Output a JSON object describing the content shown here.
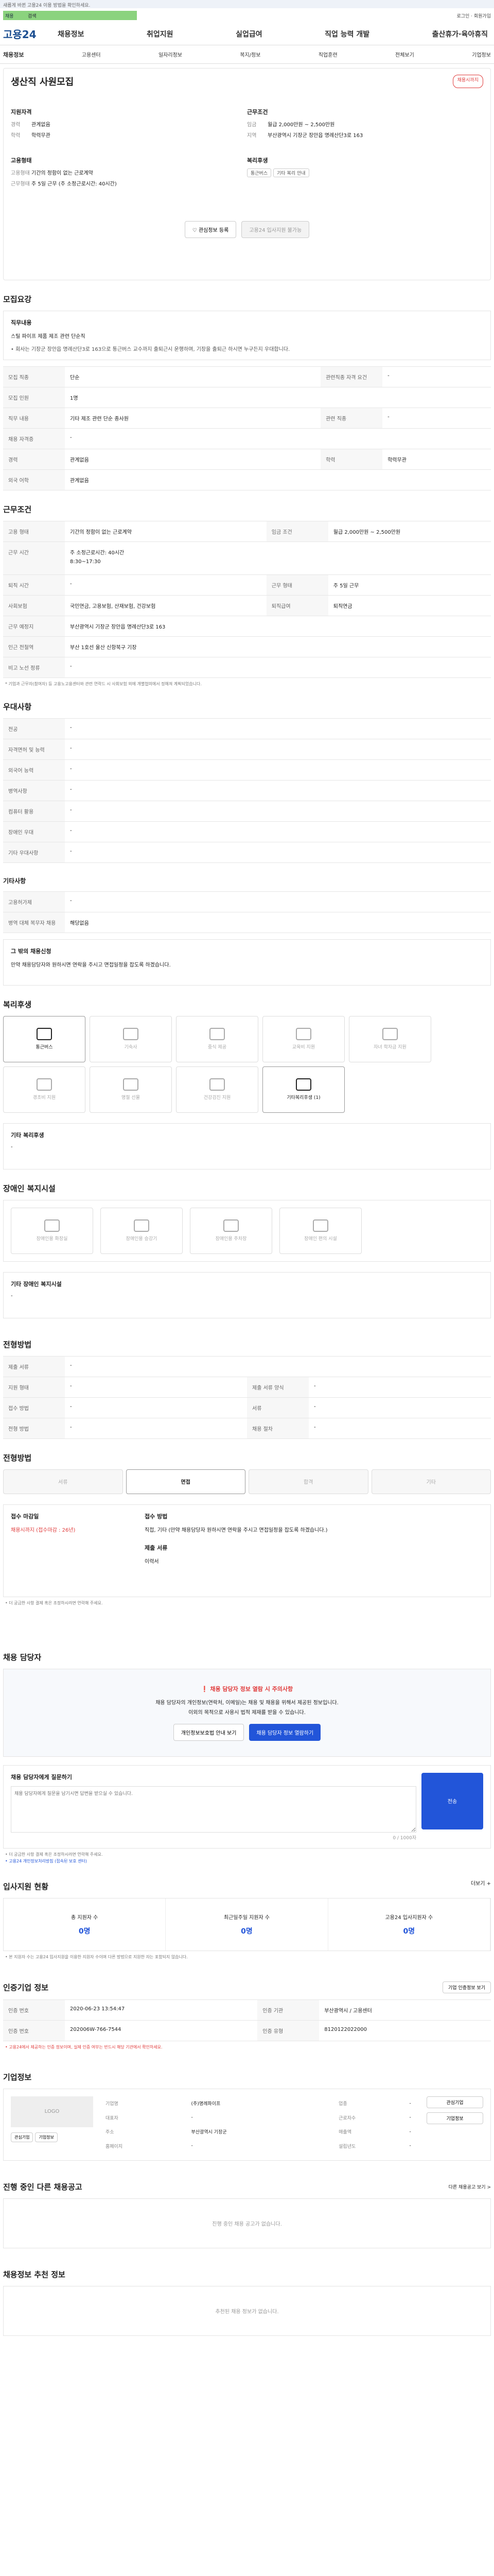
{
  "topbar": {
    "notice": "새롭게 바뀐 고용24 이용 방법을 확인하세요.",
    "search_prefix": "채용",
    "search_value": "검색",
    "right": "로그인 · 회원가입"
  },
  "gnb": {
    "logo": "고용24",
    "menu": [
      "채용정보",
      "취업지원",
      "실업급여",
      "직업 능력 개발",
      "출산휴가·육아휴직"
    ]
  },
  "lnb": [
    "채용정보",
    "고용센터",
    "일자리정보",
    "복지/정보",
    "직업훈련",
    "전체보기",
    "기업정보"
  ],
  "job": {
    "title": "생산직 사원모집",
    "badge": "채용시까지",
    "apply_label": "지원자격",
    "career_label": "경력",
    "career": "관계없음",
    "edu_label": "학력",
    "edu": "학력무관",
    "cond_title": "근무조건",
    "pay_label": "임금",
    "pay": "월급 2,000만원 ~ 2,500만원",
    "loc_label": "지역",
    "loc": "부산광역시 기장군 장안읍 명례산단3로 163",
    "type_title": "고용형태",
    "type_label": "고용형태",
    "type_val": "기간의 정함이 없는 근로계약",
    "hours_label": "근무형태",
    "hours_val": "주 5일 근무 (주 소정근로시간: 40시간)",
    "welfare_title": "복리후생",
    "tags": [
      "통근버스",
      "기타 복리 안내"
    ],
    "btn_save": "관심정보 등록",
    "btn_apply": "고용24 입사지원 불가능"
  },
  "sections": {
    "recruit": "모집요강",
    "cond": "근무조건",
    "pref": "우대사항",
    "welfare": "복리후생",
    "disabled": "장애인 복지시설",
    "selection": "전형방법",
    "contact": "채용 담당자",
    "stats": "입사지원 현황",
    "company": "인증기업 정보",
    "corp": "기업정보",
    "other": "진행 중인 다른 채용공고",
    "ai": "채용정보 추천 정보"
  },
  "recruit": {
    "box_title": "직무내용",
    "box_text": "스틸 파이프 제품 제조 관련 단순직",
    "box_note": "• 회사는 기장군 장안읍 명례산단3로 163으로 통근버스 교수까지 출퇴근시 운행하며, 기장을 출퇴근 하시면 누구든지 우대합니다.",
    "rows": [
      [
        "모집 직종",
        "단순",
        "관련직종 자격 요건",
        "-"
      ],
      [
        "모집 인원",
        "1명",
        "",
        ""
      ],
      [
        "직무 내용",
        "기타 제조 관련 단순 종사원",
        "관련 직종",
        "-"
      ],
      [
        "채용 자격증",
        "-",
        "",
        ""
      ],
      [
        "경력",
        "관계없음",
        "학력",
        "학력무관"
      ],
      [
        "외국 어학",
        "관계없음",
        "",
        ""
      ]
    ]
  },
  "cond": {
    "rows": [
      [
        "고용 형태",
        "기간의 정함이 없는 근로계약",
        "임금 조건",
        "월급 2,000만원 ~ 2,500만원"
      ],
      [
        "근무 시간",
        "주 소정근로시간: 40시간",
        "근무형태",
        "주 5일 근무"
      ],
      [
        "퇴직 시간",
        "-",
        "근무 형태",
        "주 5일 근무"
      ],
      [
        "사회보험",
        "국민연금, 고용보험, 산재보험, 건강보험",
        "퇴직급여",
        "퇴직연금"
      ],
      [
        "근무 예정지",
        "부산광역시 기장군 장안읍 명례산단3로 163",
        "",
        ""
      ],
      [
        "인근 전철역",
        "부산 1호선 울산 신항북구 기장",
        "",
        ""
      ],
      [
        "비고 노선 정류",
        "-",
        "",
        ""
      ]
    ],
    "hours_detail": "8:30~17:30",
    "note": "* 기업과 근무자(참여자) 등 고용노고용센터와 관련 연락드 시 사회보험 외에 개별협의에서 정해져 계획되었습니다."
  },
  "pref": {
    "rows": [
      [
        "전공",
        "-"
      ],
      [
        "자격면허 및 능력",
        "-"
      ],
      [
        "외국어 능력",
        "-"
      ],
      [
        "병역사항",
        "-"
      ],
      [
        "컴퓨터 활용",
        "-"
      ],
      [
        "장애인 우대",
        "-"
      ],
      [
        "기타 우대사항",
        "-"
      ]
    ],
    "sub_title": "기타사항",
    "sub_rows": [
      [
        "고용허가제",
        "-"
      ],
      [
        "병역 대체 복무자 채용",
        "해당없음"
      ]
    ],
    "etc_title": "그 밖의 채용신청",
    "etc_text": "만약 채용담당자와 원하시면 연락을 주시고 면접일정을 잡도록 하겠습니다."
  },
  "welfare": {
    "items": [
      {
        "label": "통근버스",
        "on": true
      },
      {
        "label": "기숙사",
        "on": false
      },
      {
        "label": "중식 제공",
        "on": false
      },
      {
        "label": "교육비 지원",
        "on": false
      },
      {
        "label": "자녀 학자금 지원",
        "on": false
      },
      {
        "label": "경조비 지원",
        "on": false
      },
      {
        "label": "명절 선물",
        "on": false
      },
      {
        "label": "건강검진 지원",
        "on": false
      },
      {
        "label": "기타복리후생 (1)",
        "on": true
      }
    ],
    "etc_label": "기타 복리후생",
    "etc_text": "-"
  },
  "disabled": {
    "items": [
      "장애인용 화장실",
      "장애인용 승강기",
      "장애인용 주차장",
      "장애인 편의 시설"
    ],
    "etc_label": "기타 장애인 복지시설",
    "etc_text": "-"
  },
  "selection": {
    "rows": [
      [
        "제출 서류",
        "-",
        "",
        ""
      ],
      [
        "지원 형태",
        "-",
        "제출 서류 양식",
        "-"
      ],
      [
        "접수 방법",
        "-",
        "서류",
        "-"
      ],
      [
        "전형 방법",
        "-",
        "채용 절차",
        "-"
      ]
    ],
    "steps": [
      "서류",
      "면접",
      "합격",
      "기타"
    ],
    "active": 1,
    "deadline_label": "접수 마감일",
    "deadline": "채용시까지 (접수마감 : 26년)",
    "method_label": "접수 방법",
    "method_text": "직접, 기타 (만약 채용담당자 원하시면 연락을 주시고 면접일정을 잡도록 하겠습니다.)",
    "docs_label": "제출 서류",
    "docs_text": "이력서"
  },
  "contact": {
    "warn": "채용 담당자 정보 열람 시 주의사항",
    "desc": "채용 담당자의 개인정보(연락처, 이메일)는 채용 및 채용을 위해서 제공된 정보입니다.",
    "desc2": "이외의 목적으로 사용시 법적 제재를 받을 수 있습니다.",
    "btn_info": "개인정보보호법 안내 보기",
    "btn_view": "채용 담당자 정보 열람하기",
    "msg_label": "채용 담당자에게 질문하기",
    "msg_placeholder": "채용 담당자에게 질문을 남기시면 답변을 받으실 수 있습니다.",
    "counter": "0 / 1000자",
    "send": "전송",
    "note1": "• 더 궁금한 사항 결제 혹은 조정하시려면 연락해 주세요.",
    "note2": "• 고용24 개인정보처리방침 (접속된 보호 센터)"
  },
  "stats": {
    "more": "더보기 +",
    "items": [
      {
        "label": "총 지원자 수",
        "value": "0명"
      },
      {
        "label": "최근일주일 지원자 수",
        "value": "0명"
      },
      {
        "label": "고용24 입사지원자 수",
        "value": "0명"
      }
    ],
    "note": "• 본 지원자 수는 고용24 입사지원을 이용한 지원자 수이며 다른 방법으로 지원한 자는 포함되지 않습니다."
  },
  "company": {
    "btn": "기업 인증정보 보기",
    "rows": [
      [
        "인증 번호",
        "2020-06-23 13:54:47",
        "인증 기관",
        "부산광역시 / 고용센터"
      ],
      [
        "인증 번호",
        "202006W-766-7544",
        "인증 유형",
        "8120122022000"
      ]
    ],
    "note": "• 고용24에서 제공하는 인증 정보이며, 실제 인증 여부는 반드시 해당 기관에서 확인하세요."
  },
  "corp": {
    "logo_text": "LOGO",
    "btn1": "관심기업",
    "btn2": "기업정보",
    "rows": [
      [
        "기업명",
        "(주)명례파이프",
        "업종",
        "-"
      ],
      [
        "대표자",
        "-",
        "근로자수",
        "-"
      ],
      [
        "주소",
        "부산광역시 기장군",
        "매출액",
        "-"
      ],
      [
        "홈페이지",
        "-",
        "설립년도",
        "-"
      ]
    ],
    "side1": "관심기업",
    "side2": "기업정보"
  },
  "other": {
    "more": "다른 채용공고 보기 >",
    "empty": "진행 중인 채용 공고가 없습니다."
  },
  "ai": {
    "empty": "추천된 채용 정보가 없습니다."
  }
}
